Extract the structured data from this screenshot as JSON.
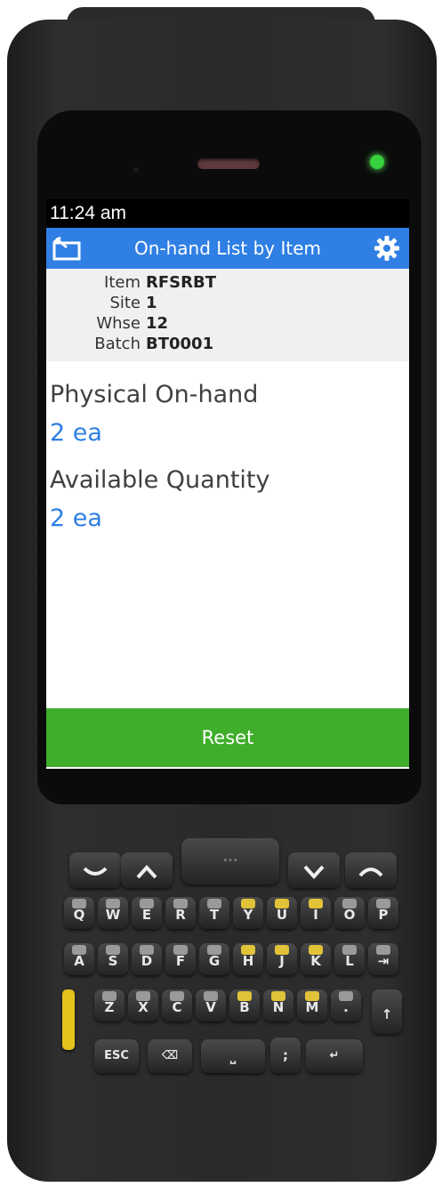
{
  "status_bar": {
    "time": "11:24 am"
  },
  "header": {
    "title": "On-hand List by Item",
    "exit_icon": "exit-icon",
    "settings_icon": "gear-icon"
  },
  "info": {
    "item_label": "Item",
    "item_value": "RFSRBT",
    "site_label": "Site",
    "site_value": "1",
    "whse_label": "Whse",
    "whse_value": "12",
    "batch_label": "Batch",
    "batch_value": "BT0001"
  },
  "physical": {
    "label": "Physical On-hand",
    "value": "2 ea"
  },
  "available": {
    "label": "Available Quantity",
    "value": "2 ea"
  },
  "footer": {
    "reset_label": "Reset"
  },
  "keypad": {
    "row1": [
      "Q",
      "W",
      "E",
      "R",
      "T",
      "Y",
      "U",
      "I",
      "O",
      "P"
    ],
    "row2": [
      "A",
      "S",
      "D",
      "F",
      "G",
      "H",
      "J",
      "K",
      "L",
      "⇥"
    ],
    "row3": [
      "Z",
      "X",
      "C",
      "V",
      "B",
      "N",
      "M",
      "."
    ],
    "esc_label": "ESC",
    "colors": {
      "yellow": "#e1c33a",
      "grey": "#9a9a9a"
    }
  }
}
